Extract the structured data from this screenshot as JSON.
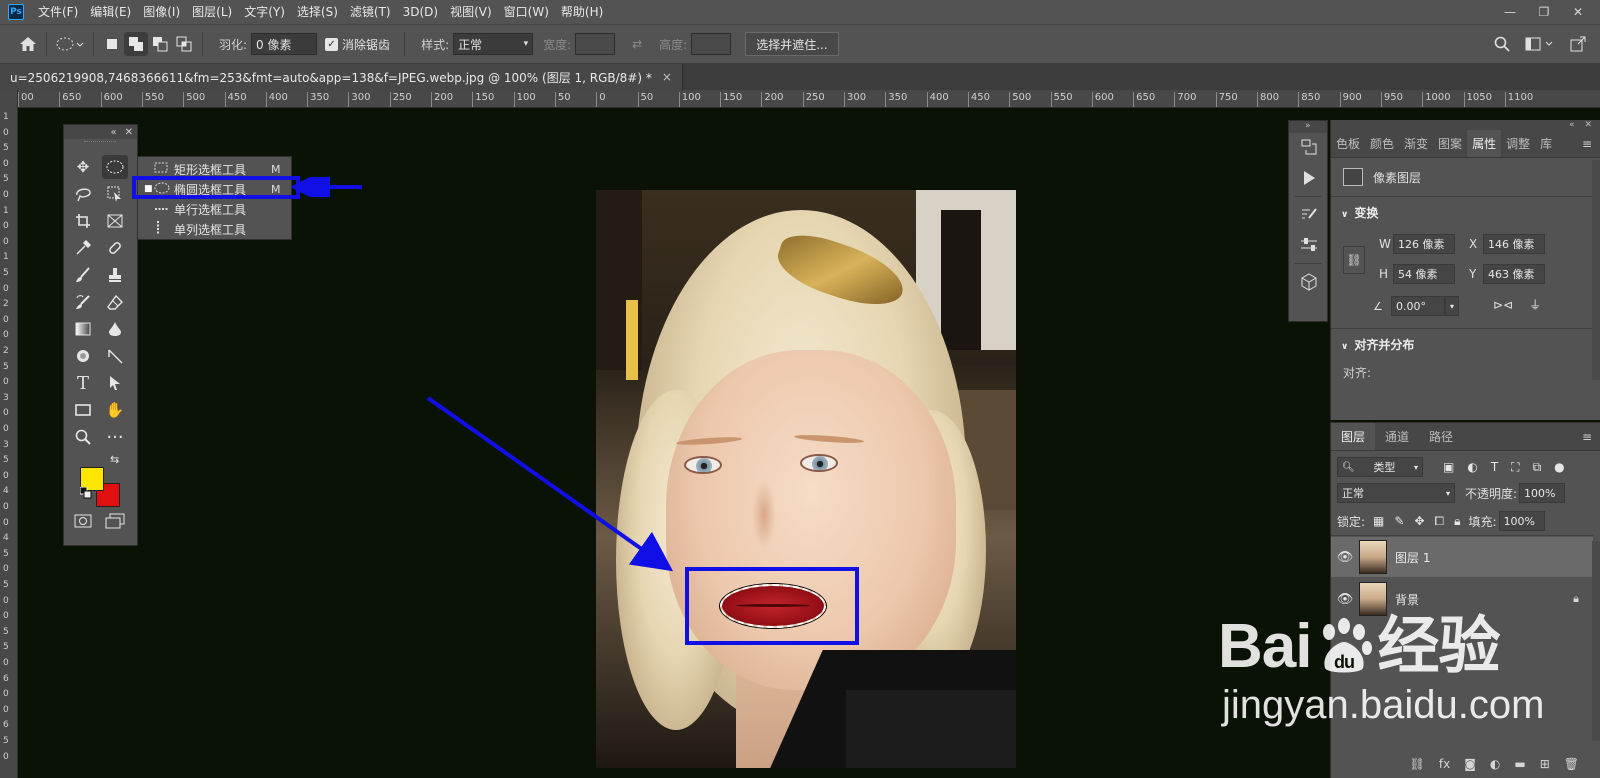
{
  "app": {
    "logo": "Ps"
  },
  "menubar": {
    "items": [
      "文件(F)",
      "编辑(E)",
      "图像(I)",
      "图层(L)",
      "文字(Y)",
      "选择(S)",
      "滤镜(T)",
      "3D(D)",
      "视图(V)",
      "窗口(W)",
      "帮助(H)"
    ],
    "window_buttons": {
      "minimize": "—",
      "restore": "❐",
      "close": "✕"
    }
  },
  "options": {
    "feather_label": "羽化:",
    "feather_value": "0 像素",
    "antialias_label": "消除锯齿",
    "antialias_checked": true,
    "style_label": "样式:",
    "style_value": "正常",
    "width_label": "宽度:",
    "height_label": "高度:",
    "select_mask_button": "选择并遮住..."
  },
  "document": {
    "tab_title": "u=2506219908,7468366611&fm=253&fmt=auto&app=138&f=JPEG.webp.jpg @ 100% (图层 1, RGB/8#) *",
    "close": "×"
  },
  "ruler": {
    "h_labels": [
      "00",
      "650",
      "600",
      "550",
      "500",
      "450",
      "400",
      "350",
      "300",
      "250",
      "200",
      "150",
      "100",
      "50",
      "0",
      "50",
      "100",
      "150",
      "200",
      "250",
      "300",
      "350",
      "400",
      "450",
      "500",
      "550",
      "600",
      "650",
      "700",
      "750",
      "800",
      "850",
      "900",
      "950",
      "1000",
      "1050",
      "1100"
    ],
    "v_labels": [
      "1",
      "0",
      "5",
      "0",
      "5",
      "0",
      "1",
      "0",
      "0",
      "1",
      "5",
      "0",
      "2",
      "0",
      "0",
      "2",
      "5",
      "0",
      "3",
      "0",
      "0",
      "3",
      "5",
      "0",
      "4",
      "0",
      "0",
      "4",
      "5",
      "0",
      "5",
      "0",
      "0",
      "5",
      "5",
      "0",
      "6",
      "0",
      "0",
      "6",
      "5",
      "0"
    ]
  },
  "toolbar": {
    "header_collapse": "«",
    "header_close": "✕",
    "foreground_color": "#ffe600",
    "background_color": "#e01010"
  },
  "flyout": {
    "items": [
      {
        "label": "矩形选框工具",
        "key": "M",
        "active": false
      },
      {
        "label": "椭圆选框工具",
        "key": "M",
        "active": true
      },
      {
        "label": "单行选框工具",
        "key": "",
        "active": false
      },
      {
        "label": "单列选框工具",
        "key": "",
        "active": false
      }
    ]
  },
  "properties": {
    "tabs": [
      "色板",
      "颜色",
      "渐变",
      "图案",
      "属性",
      "调整",
      "库"
    ],
    "active_tab": "属性",
    "layer_type": "像素图层",
    "transform_title": "变换",
    "w_label": "W",
    "w_value": "126 像素",
    "h_label": "H",
    "h_value": "54 像素",
    "x_label": "X",
    "x_value": "146 像素",
    "y_label": "Y",
    "y_value": "463 像素",
    "angle_value": "0.00°",
    "align_title": "对齐并分布",
    "align_label": "对齐:"
  },
  "layers": {
    "tabs": [
      "图层",
      "通道",
      "路径"
    ],
    "filter_value": "类型",
    "blend_mode": "正常",
    "opacity_label": "不透明度:",
    "opacity_value": "100%",
    "lock_label": "锁定:",
    "fill_label": "填充:",
    "fill_value": "100%",
    "items": [
      {
        "name": "图层 1",
        "selected": true,
        "locked": false
      },
      {
        "name": "背景",
        "selected": false,
        "locked": true
      }
    ]
  },
  "watermark": {
    "brand_left": "Bai",
    "brand_right": "经验",
    "url": "jingyan.baidu.com"
  },
  "colors": {
    "highlight": "#1010e6",
    "ui_panel": "#535353",
    "canvas_bg": "#0a1206"
  }
}
